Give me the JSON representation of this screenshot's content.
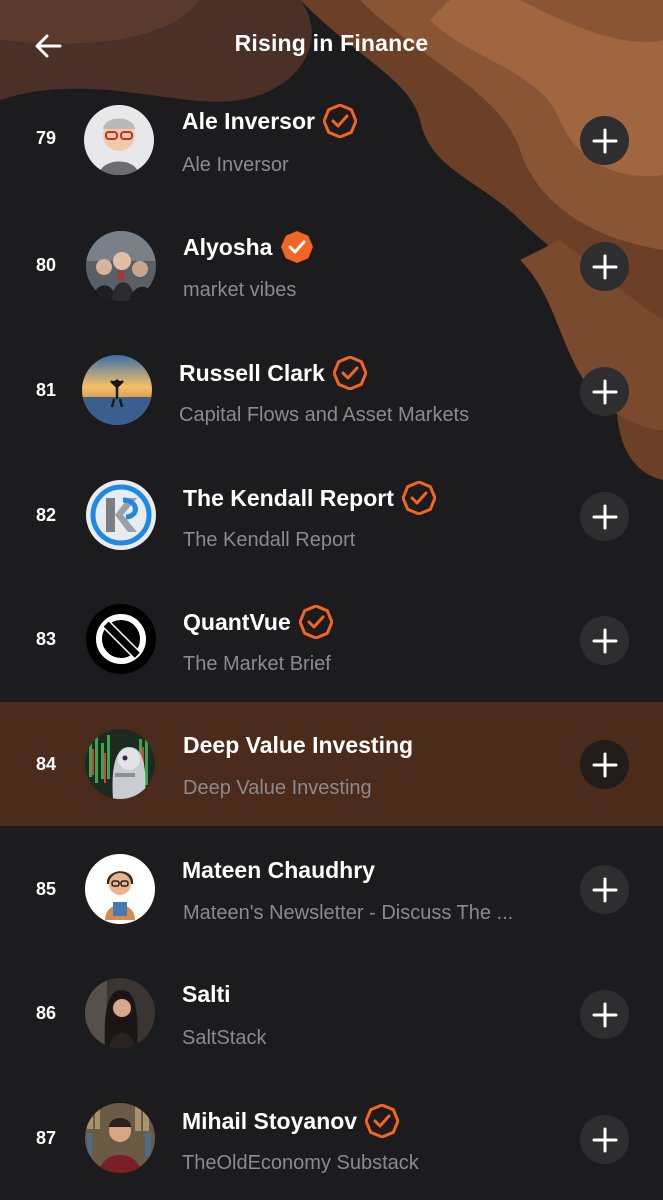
{
  "header": {
    "title": "Rising in Finance"
  },
  "colors": {
    "accent": "#f26522",
    "highlight_row": "#4a2b1c",
    "background": "#1c1b1d"
  },
  "items": [
    {
      "rank": "79",
      "name": "Ale Inversor",
      "subtitle": "Ale Inversor",
      "verified": true,
      "badge_style": "outline"
    },
    {
      "rank": "80",
      "name": "Alyosha",
      "subtitle": "market vibes",
      "verified": true,
      "badge_style": "filled"
    },
    {
      "rank": "81",
      "name": "Russell Clark",
      "subtitle": "Capital Flows and Asset Markets",
      "verified": true,
      "badge_style": "outline"
    },
    {
      "rank": "82",
      "name": "The Kendall Report",
      "subtitle": "The Kendall Report",
      "verified": true,
      "badge_style": "outline"
    },
    {
      "rank": "83",
      "name": "QuantVue",
      "subtitle": "The Market Brief",
      "verified": true,
      "badge_style": "outline"
    },
    {
      "rank": "84",
      "name": "Deep Value Investing",
      "subtitle": "Deep Value Investing",
      "verified": false,
      "highlighted": true
    },
    {
      "rank": "85",
      "name": "Mateen Chaudhry",
      "subtitle": "Mateen's Newsletter - Discuss The ...",
      "verified": false
    },
    {
      "rank": "86",
      "name": "Salti",
      "subtitle": "SaltStack",
      "verified": false
    },
    {
      "rank": "87",
      "name": "Mihail Stoyanov",
      "subtitle": "TheOldEconomy Substack",
      "verified": true,
      "badge_style": "outline"
    }
  ]
}
